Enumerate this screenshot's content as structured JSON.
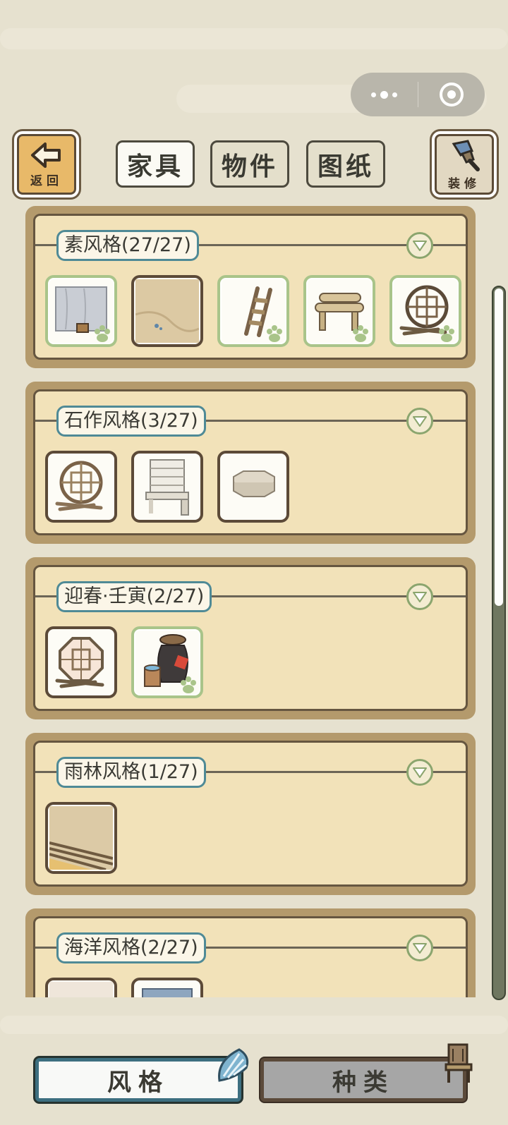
{
  "capsule": {
    "menu_icon": "more-dots-icon",
    "close_icon": "target-icon"
  },
  "header": {
    "back_label": "返回",
    "decorate_label": "装修",
    "tabs": [
      {
        "label": "家具",
        "active": true
      },
      {
        "label": "物件",
        "active": false
      },
      {
        "label": "图纸",
        "active": false
      }
    ]
  },
  "sections": [
    {
      "title": "素风格(27/27)",
      "items": [
        {
          "icon": "wall-with-bucket-icon",
          "owned": true
        },
        {
          "icon": "sandy-floor-icon",
          "owned": false
        },
        {
          "icon": "wooden-ladder-icon",
          "owned": true
        },
        {
          "icon": "log-bench-icon",
          "owned": true
        },
        {
          "icon": "round-lattice-window-icon",
          "owned": true
        }
      ]
    },
    {
      "title": "石作风格(3/27)",
      "items": [
        {
          "icon": "round-lattice-window-icon",
          "owned": false
        },
        {
          "icon": "stone-shelf-icon",
          "owned": false
        },
        {
          "icon": "stone-table-icon",
          "owned": false
        }
      ]
    },
    {
      "title": "迎春·壬寅(2/27)",
      "items": [
        {
          "icon": "octagonal-window-icon",
          "owned": false
        },
        {
          "icon": "wine-jar-icon",
          "owned": true
        }
      ]
    },
    {
      "title": "雨林风格(1/27)",
      "items": [
        {
          "icon": "wooden-floor-icon",
          "owned": false
        }
      ]
    },
    {
      "title": "海洋风格(2/27)",
      "items": [
        {
          "icon": "pale-floor-icon",
          "owned": false
        },
        {
          "icon": "blue-rug-icon",
          "owned": false
        }
      ]
    }
  ],
  "bottom_tabs": [
    {
      "label": "风格",
      "active": true,
      "icon": "seashell-icon"
    },
    {
      "label": "种类",
      "active": false,
      "icon": "chair-icon"
    }
  ],
  "colors": {
    "background": "#e6e1cf",
    "panel": "#f2e2b9",
    "frame": "#b49a6c",
    "owned_border": "#a9c48a",
    "accent": "#3d6f80"
  }
}
